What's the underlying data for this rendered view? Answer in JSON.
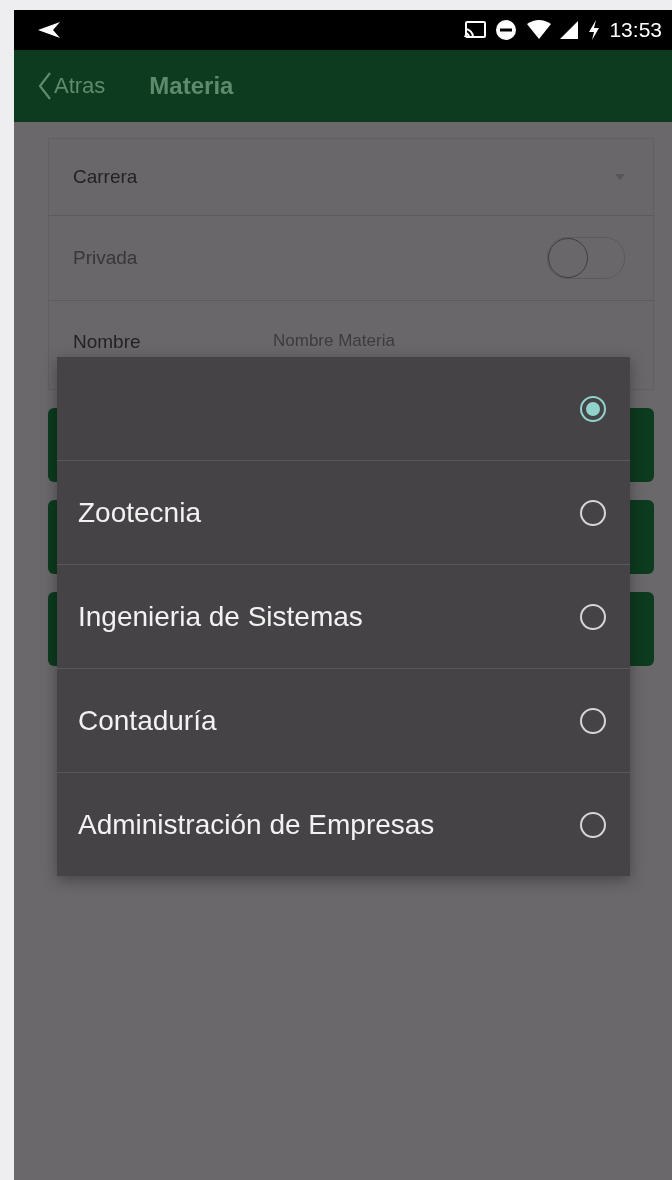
{
  "status_bar": {
    "time": "13:53"
  },
  "header": {
    "back_label": "Atras",
    "title": "Materia"
  },
  "form": {
    "carrera": {
      "label": "Carrera"
    },
    "privada": {
      "label": "Privada",
      "on": false
    },
    "nombre": {
      "label": "Nombre",
      "placeholder": "Nombre Materia"
    }
  },
  "dialog": {
    "options": [
      {
        "selected": true
      },
      {
        "label": "Zootecnia",
        "selected": false
      },
      {
        "label": "Ingenieria de Sistemas",
        "selected": false
      },
      {
        "label": "Contaduría",
        "selected": false
      },
      {
        "label": "Administración de Empresas",
        "selected": false
      }
    ]
  }
}
